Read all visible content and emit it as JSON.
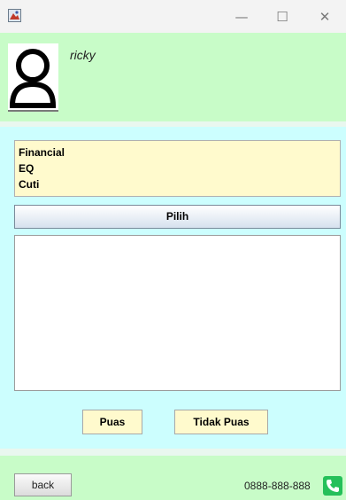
{
  "titlebar": {
    "minimize_glyph": "—",
    "maximize_glyph": "☐",
    "close_glyph": "✕"
  },
  "profile": {
    "username": "ricky",
    "avatar_icon": "user-silhouette-icon"
  },
  "menu": {
    "items": [
      {
        "label": "Financial"
      },
      {
        "label": "EQ"
      },
      {
        "label": "Cuti"
      }
    ]
  },
  "actions": {
    "pilih_label": "Pilih",
    "puas_label": "Puas",
    "tidak_puas_label": "Tidak Puas"
  },
  "footer": {
    "back_label": "back",
    "phone_number": "0888-888-888",
    "phone_icon": "phone-icon"
  },
  "colors": {
    "green_panel": "#c8fcc8",
    "cyan_panel": "#ccfefe",
    "yellow_item": "#fffacd",
    "phone_green": "#25c05a"
  }
}
